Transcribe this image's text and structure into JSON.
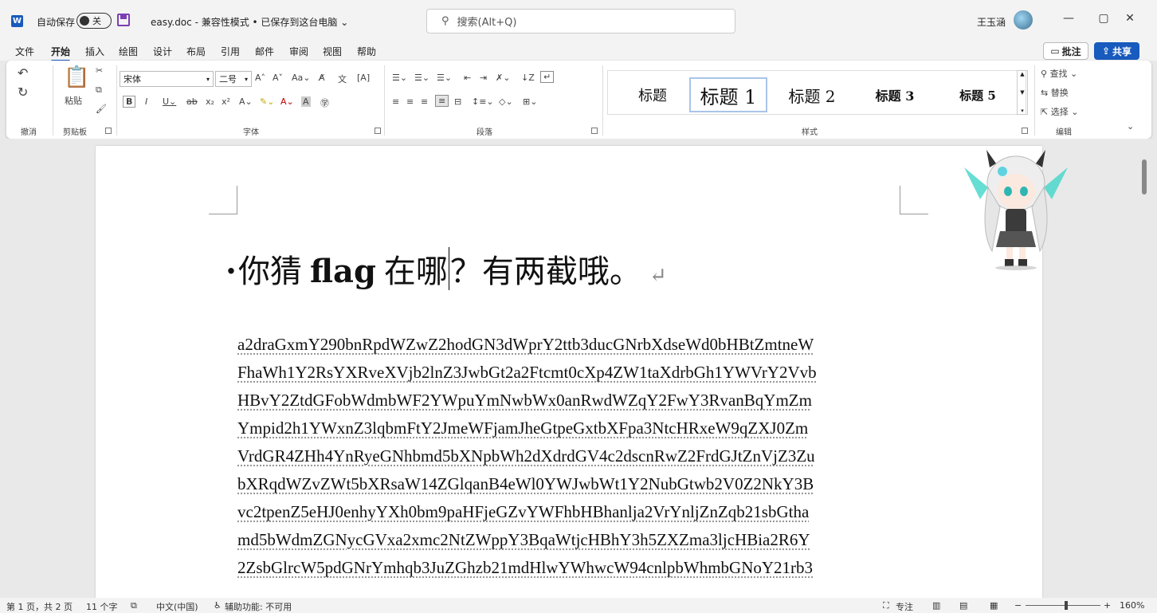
{
  "titlebar": {
    "app_logo": "W",
    "autosave_label": "自动保存",
    "autosave_state": "关",
    "doc_title": "easy.doc - 兼容性模式 • 已保存到这台电脑 ⌄",
    "search_placeholder": "搜索(Alt+Q)",
    "user_name": "王玉涵",
    "minimize": "—",
    "restore": "▢",
    "close": "✕"
  },
  "menu": {
    "items": [
      "文件",
      "开始",
      "插入",
      "绘图",
      "设计",
      "布局",
      "引用",
      "邮件",
      "审阅",
      "视图",
      "帮助"
    ],
    "active_index": 1,
    "comment_label": "批注",
    "share_label": "共享"
  },
  "ribbon": {
    "undo_group": "撤消",
    "clipboard_group": "剪贴板",
    "paste_label": "粘贴",
    "font_group": "字体",
    "font_name": "宋体",
    "font_size": "二号",
    "paragraph_group": "段落",
    "styles_group": "样式",
    "editing_group": "编辑",
    "styles": [
      "标题",
      "标题 1",
      "标题 2",
      "标题 3",
      "标题 5"
    ],
    "find_label": "查找",
    "replace_label": "替换",
    "select_label": "选择"
  },
  "document": {
    "heading_bullet": "·",
    "heading_part1": "你猜",
    "heading_bold": "flag",
    "heading_part2": "在哪",
    "heading_part3": "？有两截哦。",
    "heading_para_mark": "↵",
    "lines": [
      "a2draGxmY290bnRpdWZwZ2hodGN3dWprY2ttb3ducGNrbXdseWd0bHBtZmtneW",
      "FhaWh1Y2RsYXRveXVjb2lnZ3JwbGt2a2Ftcmt0cXp4ZW1taXdrbGh1YWVrY2Vvb",
      "HBvY2ZtdGFobWdmbWF2YWpuYmNwbWx0anRwdWZqY2FwY3RvanBqYmZm",
      "Ympid2h1YWxnZ3lqbmFtY2JmeWFjamJheGtpeGxtbXFpa3NtcHRxeW9qZXJ0Zm",
      "VrdGR4ZHh4YnRyeGNhbmd5bXNpbWh2dXdrdGV4c2dscnRwZ2FrdGJtZnVjZ3Zu",
      "bXRqdWZvZWt5bXRsaW14ZGlqanB4eWl0YWJwbWt1Y2NubGtwb2V0Z2NkY3B",
      "vc2tpenZ5eHJ0enhyYXh0bm9paHFjeGZvYWFhbHBhanlja2VrYnljZnZqb21sbGtha",
      "md5bWdmZGNycGVxa2xmc2NtZWppY3BqaWtjcHBhY3h5ZXZma3ljcHBia2R6Y",
      "2ZsbGlrcW5pdGNrYmhqb3JuZGhzb21mdHlwYWhwcW94cnlpbWhmbGNoY21rb3"
    ]
  },
  "status": {
    "page": "第 1 页，共 2 页",
    "words": "11 个字",
    "language": "中文(中国)",
    "accessibility": "辅助功能: 不可用",
    "focus": "专注",
    "zoom_minus": "−",
    "zoom_plus": "+",
    "zoom": "160%"
  }
}
